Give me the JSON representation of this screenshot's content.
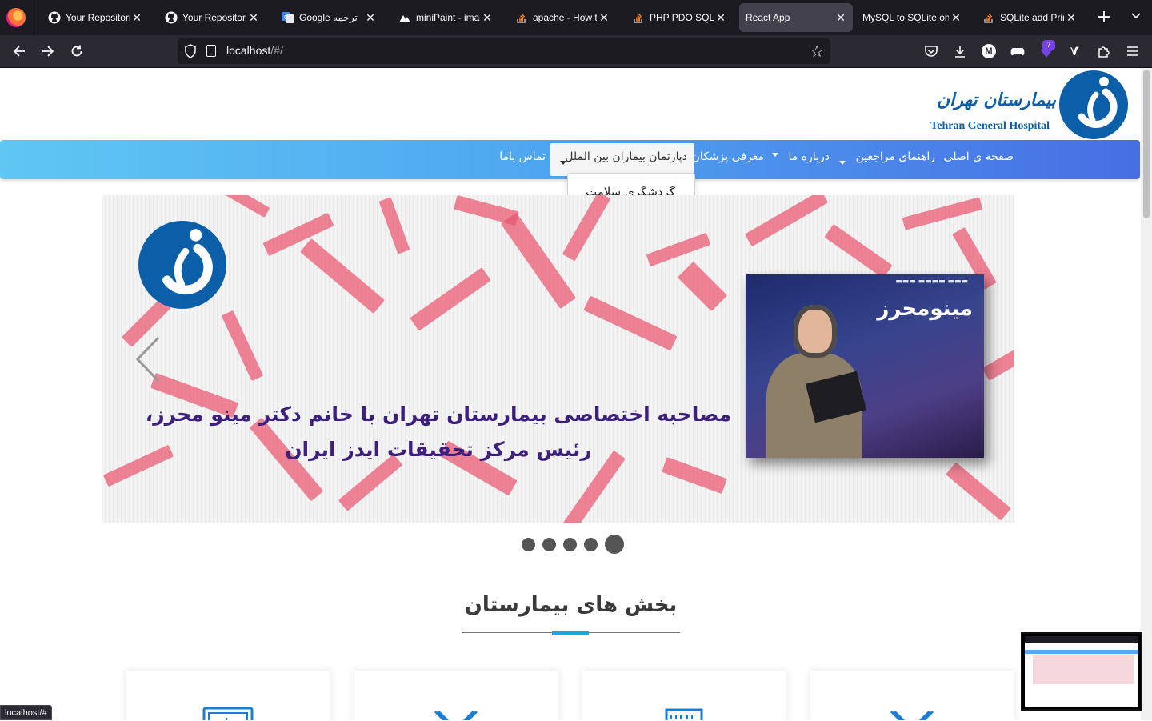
{
  "browser": {
    "tabs": [
      {
        "title": "Your Repositories",
        "icon": "github-icon",
        "active": false
      },
      {
        "title": "Your Repositories",
        "icon": "github-icon",
        "active": false
      },
      {
        "title": "Google ترجمه",
        "icon": "google-translate-icon",
        "active": false
      },
      {
        "title": "miniPaint - image editor",
        "icon": "minipaint-icon",
        "active": false
      },
      {
        "title": "apache - How to",
        "icon": "stackoverflow-icon",
        "active": false
      },
      {
        "title": "PHP PDO SQLite",
        "icon": "stackoverflow-icon",
        "active": false
      },
      {
        "title": "React App",
        "icon": "",
        "active": true
      },
      {
        "title": "MySQL to SQLite online",
        "icon": "",
        "active": false
      },
      {
        "title": "SQLite add Primary",
        "icon": "stackoverflow-icon",
        "active": false
      }
    ],
    "url_host": "localhost",
    "url_path": "/#/",
    "extension_badge": "7",
    "status_url": "localhost/#"
  },
  "header": {
    "hospital_name_fa": "بیمارستان تهران",
    "hospital_name_en": "Tehran General Hospital"
  },
  "menu": {
    "items": [
      {
        "label": "صفحه ی اصلی",
        "has_caret": false
      },
      {
        "label": "راهنمای مراجعین",
        "has_caret": true
      },
      {
        "label": "درباره ما",
        "has_caret": true
      },
      {
        "label": "معرفی پزشکان",
        "has_caret": false
      },
      {
        "label": "دپارتمان بیماران بین الملل",
        "has_caret": true,
        "open": true
      },
      {
        "label": "تماس باما",
        "has_caret": false
      }
    ],
    "dropdown_items": [
      "گردشگری سلامت"
    ]
  },
  "carousel": {
    "caption_line1": "مصاحبه اختصاصی بیمارستان تهران با خانم دکتر مینو محرز،",
    "caption_line2": "رئیس مرکز تحقیقات ایدز ایران",
    "photo_banner": "مینومحرز",
    "slide_count": 5,
    "active_index": 4
  },
  "section": {
    "title": "بخش های بیمارستان"
  },
  "colors": {
    "brand_blue": "#0b5ea8",
    "menu_gradient_start": "#5fc7f3",
    "menu_gradient_end": "#476ee4",
    "accent": "#1ba3e8",
    "caption": "#3d1f7c"
  }
}
